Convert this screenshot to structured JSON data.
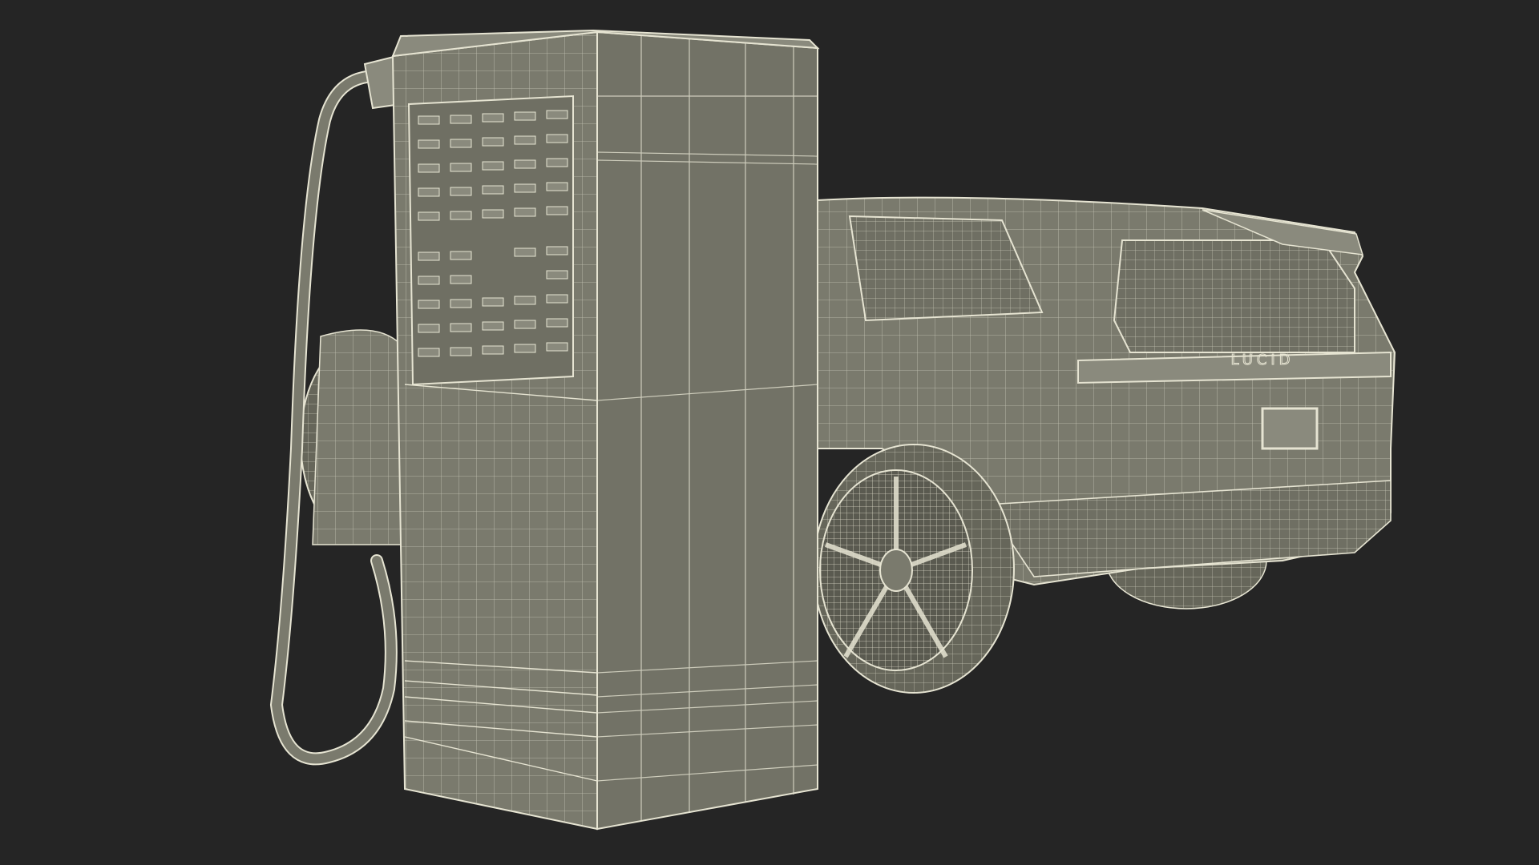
{
  "scene": {
    "background_color": "#252525",
    "mesh_fill_color": "#7a7a6d",
    "mesh_fill_dark_color": "#66665a",
    "wire_color": "#e6e4d2",
    "charger": {
      "depicts": "ev-charging-station-wireframe"
    },
    "vehicle": {
      "depicts": "suv-wireframe-rear-view",
      "badge_text": "LUCID"
    }
  }
}
